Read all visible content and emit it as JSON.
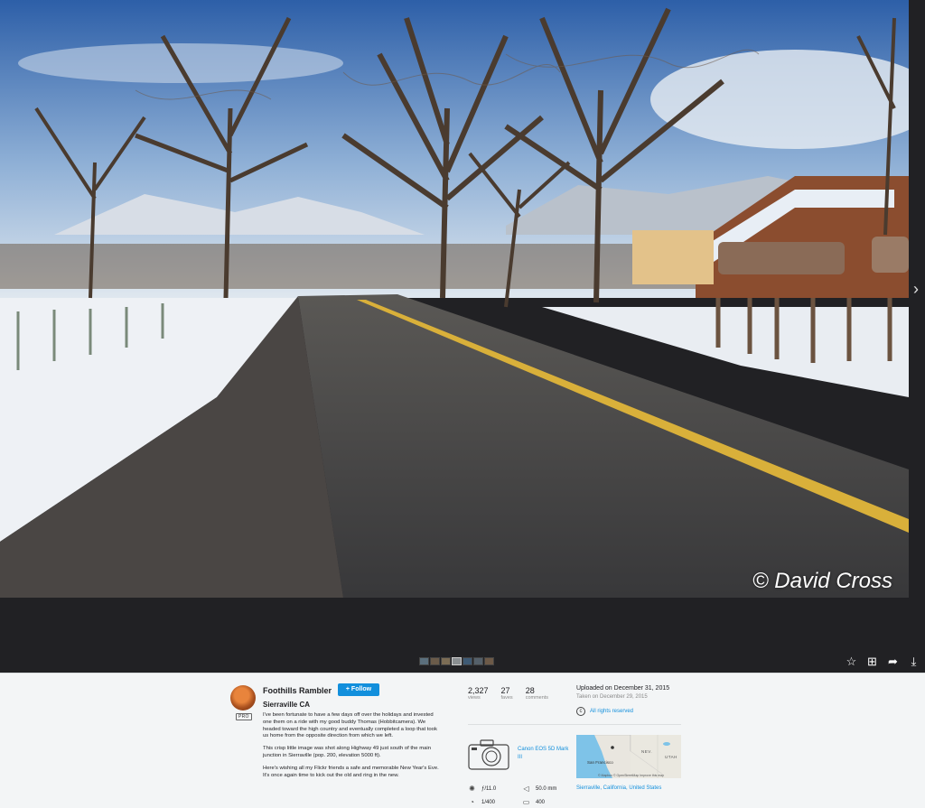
{
  "photo": {
    "watermark": "© David Cross",
    "alt": "Snowy road in Sierraville CA"
  },
  "viewer": {
    "next_icon": "chevron-right-icon",
    "filmstrip_count": 7,
    "actions": [
      "star-icon",
      "add-to-gallery-icon",
      "share-icon",
      "download-icon"
    ]
  },
  "owner": {
    "name": "Foothills Rambler",
    "badge": "PRO",
    "follow_label": "+ Follow"
  },
  "photo_info": {
    "title": "Sierraville CA",
    "description": [
      "I've been fortunate to have a few days off over the holidays and invested one them on a ride with my good buddy Thomas (Hobbitcamera). We headed toward the high country and eventually completed a loop that took us home from the opposite direction from which we left.",
      "This crisp little image was shot along Highway 49 just south of the main junction in Sierraville (pop. 200, elevation 5000 ft).",
      "Here's wishing all my Flickr friends a safe and memorable New Year's Eve. It's once again time to kick out the old and ring in the new."
    ]
  },
  "stats": [
    {
      "value": "2,327",
      "label": "views"
    },
    {
      "value": "27",
      "label": "faves"
    },
    {
      "value": "28",
      "label": "comments"
    }
  ],
  "dates": {
    "uploaded": "Uploaded on December 31, 2015",
    "taken": "Taken on December 29, 2015"
  },
  "license": {
    "text": "All rights reserved",
    "icon": "copyright-icon"
  },
  "camera": {
    "name": "Canon EOS 5D Mark III"
  },
  "exif": {
    "aperture": "ƒ/11.0",
    "focal_length": "50.0 mm",
    "shutter": "1/400",
    "iso": "400"
  },
  "map": {
    "label_city": "San Francisco",
    "label_nev": "NEV.",
    "label_utah": "UTAH",
    "attribution": "© Mapbox © OpenStreetMap  Improve this map"
  },
  "location": "Sierraville, California, United States",
  "colors": {
    "accent": "#128fdc",
    "panel_bg": "#f3f5f6",
    "viewer_bg": "#212124"
  }
}
